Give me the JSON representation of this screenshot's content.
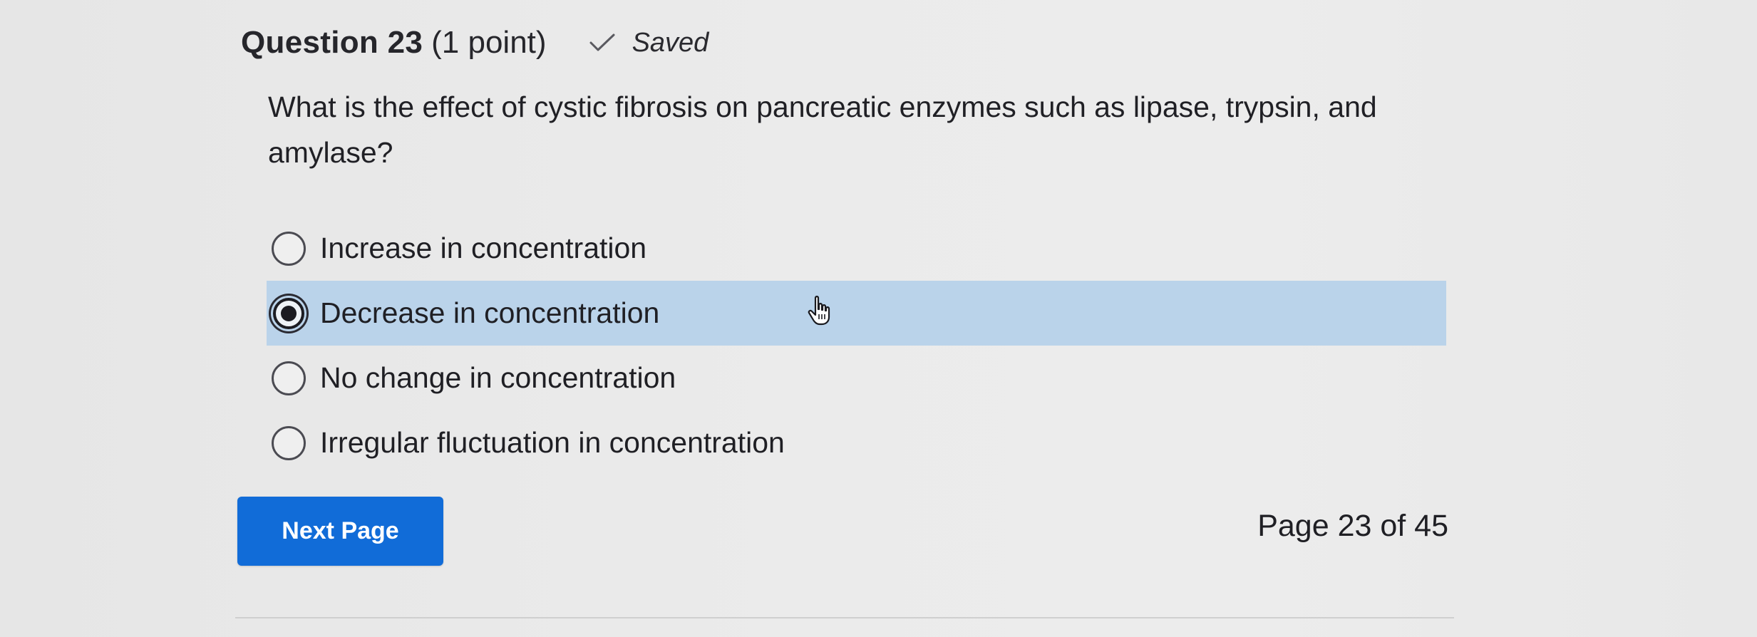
{
  "header": {
    "question_title": "Question 23",
    "points": "(1 point)",
    "saved_label": "Saved",
    "saved_icon": "check-icon"
  },
  "question": {
    "text": "What is the effect of cystic fibrosis on pancreatic enzymes such as lipase, trypsin, and amylase?"
  },
  "options": [
    {
      "label": "Increase in concentration",
      "selected": false
    },
    {
      "label": "Decrease in concentration",
      "selected": true
    },
    {
      "label": "No change in concentration",
      "selected": false
    },
    {
      "label": "Irregular fluctuation in concentration",
      "selected": false
    }
  ],
  "navigation": {
    "next_label": "Next Page",
    "page_indicator": "Page 23 of 45"
  },
  "colors": {
    "selected_highlight": "#bad3ea",
    "button_blue": "#116cd8",
    "text": "#1f1f24"
  }
}
